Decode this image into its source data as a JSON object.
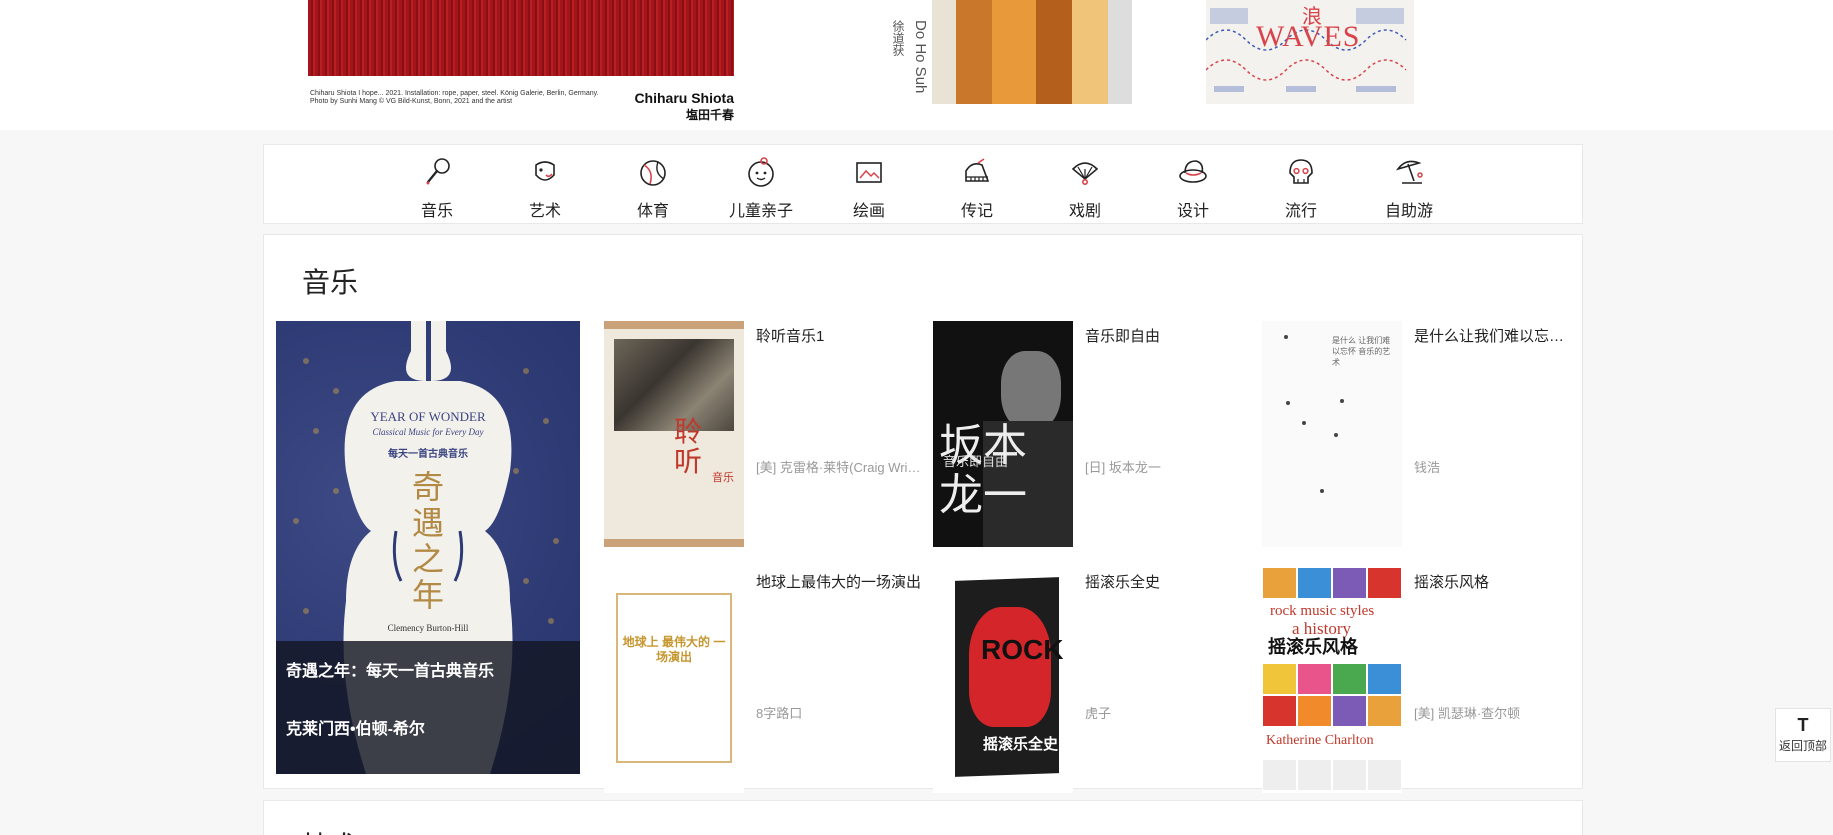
{
  "banner": {
    "poster1_caption": "Chiharu Shiota I hope... 2021. Installation: rope, paper, steel. König Galerie, Berlin, Germany. Photo by Sunhi Mang © VG Bild-Kunst, Bonn, 2021 and the artist",
    "poster1_artist_en": "Chiharu Shiota",
    "poster1_artist_zh": "塩田千春",
    "poster2_artist_zh": "徐道获",
    "poster2_artist_en": "Do Ho Suh",
    "poster3_zh": "浪",
    "poster3_en": "WAVES"
  },
  "categories": [
    {
      "label": "音乐",
      "icon": "microphone-icon"
    },
    {
      "label": "艺术",
      "icon": "mask-icon"
    },
    {
      "label": "体育",
      "icon": "ball-icon"
    },
    {
      "label": "儿童亲子",
      "icon": "child-face-icon"
    },
    {
      "label": "绘画",
      "icon": "picture-icon"
    },
    {
      "label": "传记",
      "icon": "piano-icon"
    },
    {
      "label": "戏剧",
      "icon": "fan-icon"
    },
    {
      "label": "设计",
      "icon": "hat-icon"
    },
    {
      "label": "流行",
      "icon": "skull-icon"
    },
    {
      "label": "自助游",
      "icon": "beach-umbrella-icon"
    }
  ],
  "music_section": {
    "title": "音乐",
    "feature": {
      "title": "奇遇之年：每天一首古典音乐",
      "author": "克莱门西•伯顿-希尔",
      "cover_en": "YEAR OF WONDER",
      "cover_en_sub": "Classical Music for Every Day",
      "cover_zh_sub": "每天一首古典音乐",
      "cover_zh": "奇遇之年",
      "cover_author_en": "Clemency Burton-Hill"
    },
    "books": [
      {
        "title": "聆听音乐1",
        "author": "[美] 克雷格·莱特(Craig Wright)",
        "cover_zh": "聆听",
        "cover_zh2": "音乐"
      },
      {
        "title": "音乐即自由",
        "author": "[日] 坂本龙一",
        "cover_zh": "坂本 龙一",
        "cover_sub": "音乐即自由"
      },
      {
        "title": "是什么让我们难以忘怀——经典旋律的秘密",
        "author": "钱浩",
        "cover_text": "是什么 让我们难以忘怀 音乐的艺术"
      },
      {
        "title": "地球上最伟大的一场演出",
        "author": "8字路口",
        "cover_zh": "地球上 最伟大的 一场演出"
      },
      {
        "title": "摇滚乐全史",
        "author": "虎子",
        "cover_en": "ROCK",
        "cover_zh": "摇滚乐全史"
      },
      {
        "title": "摇滚乐风格",
        "author": "[美] 凯瑟琳·查尔顿",
        "cover_en1": "rock music styles",
        "cover_en2": "a history",
        "cover_zh": "摇滚乐风格",
        "cover_author_en": "Katherine Charlton"
      }
    ]
  },
  "next_section_title": "技术",
  "back_to_top": {
    "arrow": "T",
    "label": "返回顶部"
  }
}
